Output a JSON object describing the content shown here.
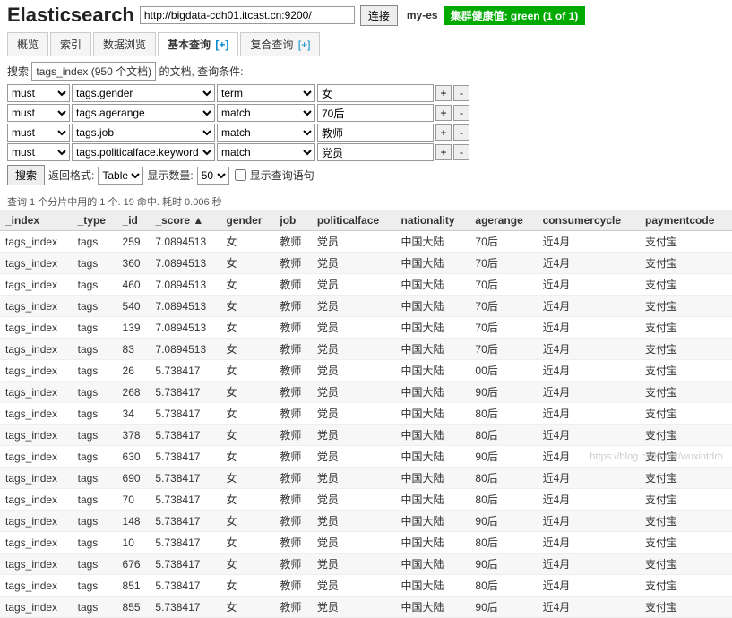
{
  "header": {
    "logo": "Elasticsearch",
    "url": "http://bigdata-cdh01.itcast.cn:9200/",
    "connect_btn": "连接",
    "cluster_name": "my-es",
    "health": "集群健康值: green (1 of 1)"
  },
  "tabs": [
    {
      "label": "概览"
    },
    {
      "label": "索引"
    },
    {
      "label": "数据浏览"
    },
    {
      "label": "基本查询",
      "plus": "[+]",
      "active": true
    },
    {
      "label": "复合查询",
      "plus": "[+]"
    }
  ],
  "query": {
    "search_label": "搜索",
    "index_info": "tags_index (950 个文档)",
    "doc_label": "的文档,",
    "cond_label": "查询条件:",
    "criteria": [
      {
        "bool": "must",
        "field": "tags.gender",
        "match": "term",
        "value": "女"
      },
      {
        "bool": "must",
        "field": "tags.agerange",
        "match": "match",
        "value": "70后"
      },
      {
        "bool": "must",
        "field": "tags.job",
        "match": "match",
        "value": "教师"
      },
      {
        "bool": "must",
        "field": "tags.politicalface.keyword",
        "match": "match",
        "value": "党员"
      }
    ],
    "search_btn": "搜索",
    "format_label": "返回格式:",
    "format_value": "Table",
    "size_label": "显示数量:",
    "size_value": "50",
    "show_query": "显示查询语句",
    "stats": "查询 1 个分片中用的 1 个. 19 命中. 耗时 0.006 秒"
  },
  "table": {
    "headers": [
      "_index",
      "_type",
      "_id",
      "_score ▲",
      "gender",
      "job",
      "politicalface",
      "nationality",
      "agerange",
      "consumercycle",
      "paymentcode"
    ],
    "rows": [
      [
        "tags_index",
        "tags",
        "259",
        "7.0894513",
        "女",
        "教师",
        "党员",
        "中国大陆",
        "70后",
        "近4月",
        "支付宝"
      ],
      [
        "tags_index",
        "tags",
        "360",
        "7.0894513",
        "女",
        "教师",
        "党员",
        "中国大陆",
        "70后",
        "近4月",
        "支付宝"
      ],
      [
        "tags_index",
        "tags",
        "460",
        "7.0894513",
        "女",
        "教师",
        "党员",
        "中国大陆",
        "70后",
        "近4月",
        "支付宝"
      ],
      [
        "tags_index",
        "tags",
        "540",
        "7.0894513",
        "女",
        "教师",
        "党员",
        "中国大陆",
        "70后",
        "近4月",
        "支付宝"
      ],
      [
        "tags_index",
        "tags",
        "139",
        "7.0894513",
        "女",
        "教师",
        "党员",
        "中国大陆",
        "70后",
        "近4月",
        "支付宝"
      ],
      [
        "tags_index",
        "tags",
        "83",
        "7.0894513",
        "女",
        "教师",
        "党员",
        "中国大陆",
        "70后",
        "近4月",
        "支付宝"
      ],
      [
        "tags_index",
        "tags",
        "26",
        "5.738417",
        "女",
        "教师",
        "党员",
        "中国大陆",
        "00后",
        "近4月",
        "支付宝"
      ],
      [
        "tags_index",
        "tags",
        "268",
        "5.738417",
        "女",
        "教师",
        "党员",
        "中国大陆",
        "90后",
        "近4月",
        "支付宝"
      ],
      [
        "tags_index",
        "tags",
        "34",
        "5.738417",
        "女",
        "教师",
        "党员",
        "中国大陆",
        "80后",
        "近4月",
        "支付宝"
      ],
      [
        "tags_index",
        "tags",
        "378",
        "5.738417",
        "女",
        "教师",
        "党员",
        "中国大陆",
        "80后",
        "近4月",
        "支付宝"
      ],
      [
        "tags_index",
        "tags",
        "630",
        "5.738417",
        "女",
        "教师",
        "党员",
        "中国大陆",
        "90后",
        "近4月",
        "支付宝"
      ],
      [
        "tags_index",
        "tags",
        "690",
        "5.738417",
        "女",
        "教师",
        "党员",
        "中国大陆",
        "80后",
        "近4月",
        "支付宝"
      ],
      [
        "tags_index",
        "tags",
        "70",
        "5.738417",
        "女",
        "教师",
        "党员",
        "中国大陆",
        "80后",
        "近4月",
        "支付宝"
      ],
      [
        "tags_index",
        "tags",
        "148",
        "5.738417",
        "女",
        "教师",
        "党员",
        "中国大陆",
        "90后",
        "近4月",
        "支付宝"
      ],
      [
        "tags_index",
        "tags",
        "10",
        "5.738417",
        "女",
        "教师",
        "党员",
        "中国大陆",
        "80后",
        "近4月",
        "支付宝"
      ],
      [
        "tags_index",
        "tags",
        "676",
        "5.738417",
        "女",
        "教师",
        "党员",
        "中国大陆",
        "90后",
        "近4月",
        "支付宝"
      ],
      [
        "tags_index",
        "tags",
        "851",
        "5.738417",
        "女",
        "教师",
        "党员",
        "中国大陆",
        "80后",
        "近4月",
        "支付宝"
      ],
      [
        "tags_index",
        "tags",
        "855",
        "5.738417",
        "女",
        "教师",
        "党员",
        "中国大陆",
        "90后",
        "近4月",
        "支付宝"
      ]
    ]
  },
  "watermark": "https://blog.csdn.net/wuxintdrh"
}
